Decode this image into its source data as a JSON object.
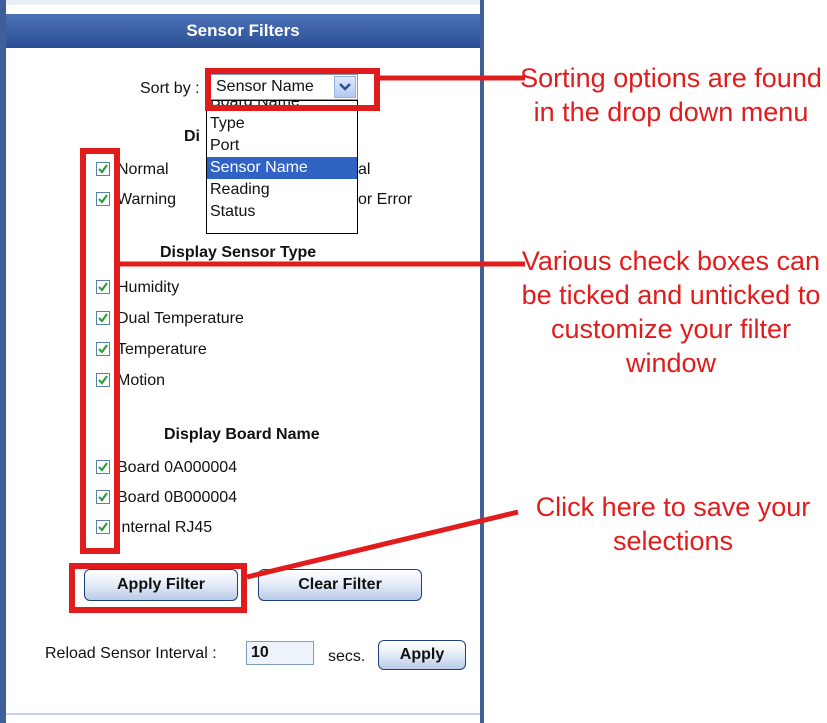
{
  "panel": {
    "title": "Sensor Filters",
    "sort_label": "Sort by :",
    "sort_selected": "Sensor Name",
    "sort_options": [
      "Board Name",
      "Type",
      "Port",
      "Sensor Name",
      "Reading",
      "Status"
    ],
    "status_heading_partial": "Di",
    "status_items": {
      "normal": "Normal",
      "warning": "Warning",
      "critical_partial": "al",
      "sensor_error_partial": "or Error"
    },
    "type_heading": "Display Sensor Type",
    "type_items": [
      "Humidity",
      "Dual Temperature",
      "Temperature",
      "Motion"
    ],
    "board_heading": "Display Board Name",
    "board_items": [
      "Board 0A000004",
      "Board 0B000004",
      "Internal RJ45"
    ],
    "apply_filter": "Apply Filter",
    "clear_filter": "Clear Filter",
    "reload_label": "Reload Sensor Interval :",
    "reload_value": "10",
    "reload_unit": "secs.",
    "apply": "Apply"
  },
  "annotations": {
    "sorting": "Sorting options are found in the drop down menu",
    "checkboxes": "Various check boxes can be ticked and unticked to customize your filter window",
    "save": "Click here to save your selections",
    "color": "#e11c1c"
  },
  "colors": {
    "title_bar": "#2b4f93",
    "dropdown_selected": "#3163c5",
    "check": "#2e9e3e"
  }
}
